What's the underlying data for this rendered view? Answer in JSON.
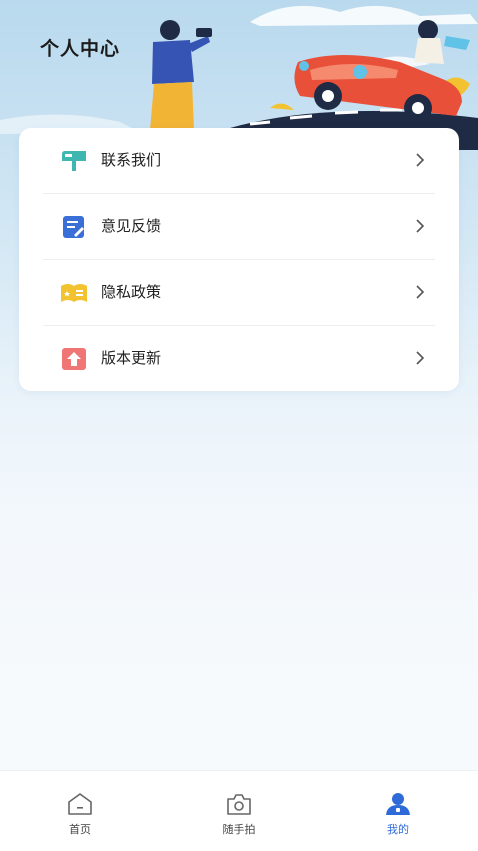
{
  "page": {
    "title": "个人中心"
  },
  "menu": {
    "items": [
      {
        "label": "联系我们",
        "icon": "mailbox-icon",
        "color": "#3fb6b0"
      },
      {
        "label": "意见反馈",
        "icon": "feedback-icon",
        "color": "#3b6fd8"
      },
      {
        "label": "隐私政策",
        "icon": "privacy-icon",
        "color": "#f2c230"
      },
      {
        "label": "版本更新",
        "icon": "update-icon",
        "color": "#f07676"
      }
    ]
  },
  "tabbar": {
    "tabs": [
      {
        "label": "首页",
        "icon": "home-icon",
        "active": false
      },
      {
        "label": "随手拍",
        "icon": "camera-icon",
        "active": false
      },
      {
        "label": "我的",
        "icon": "profile-icon",
        "active": true
      }
    ],
    "active_color": "#2f6ad9"
  }
}
